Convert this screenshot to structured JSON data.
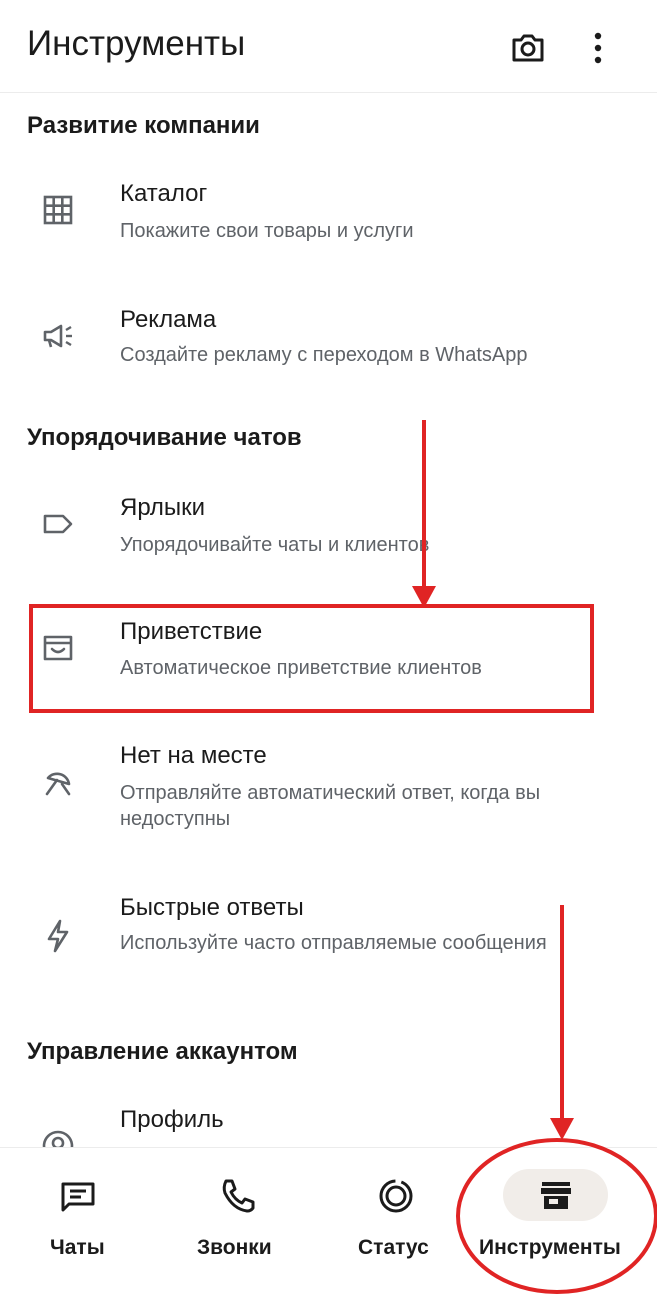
{
  "header": {
    "title": "Инструменты",
    "camera_icon": "camera-icon",
    "more_icon": "more-vert-icon"
  },
  "sections": {
    "business": "Развитие компании",
    "chats": "Упорядочивание чатов",
    "account": "Управление аккаунтом"
  },
  "items": {
    "catalog": {
      "title": "Каталог",
      "subtitle": "Покажите свои товары и услуги",
      "icon": "grid-icon"
    },
    "ads": {
      "title": "Реклама",
      "subtitle": "Создайте рекламу с переходом в WhatsApp",
      "icon": "megaphone-icon"
    },
    "labels": {
      "title": "Ярлыки",
      "subtitle": "Упорядочивайте чаты и клиентов",
      "icon": "label-icon"
    },
    "greeting": {
      "title": "Приветствие",
      "subtitle": "Автоматическое приветствие клиентов",
      "icon": "greeting-icon"
    },
    "away": {
      "title": "Нет на месте",
      "subtitle": "Отправляйте автоматический ответ, когда вы недоступны",
      "icon": "away-icon"
    },
    "quick": {
      "title": "Быстрые ответы",
      "subtitle": "Используйте часто отправляемые сообщения",
      "icon": "bolt-icon"
    },
    "profile": {
      "title": "Профиль",
      "icon": "profile-icon"
    }
  },
  "bottom_nav": {
    "chats": "Чаты",
    "calls": "Звонки",
    "status": "Статус",
    "tools": "Инструменты",
    "active": "tools"
  },
  "annotations": {
    "color": "#e02424"
  }
}
